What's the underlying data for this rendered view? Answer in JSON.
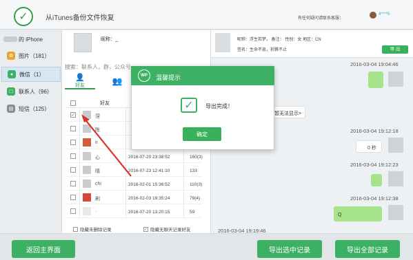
{
  "header": {
    "title": "从iTunes备份文件恢复",
    "note": "有任何疑问请联系客服：",
    "user_name": "4****5"
  },
  "sidebar": {
    "device": "的 iPhone",
    "items": [
      {
        "label": "图片（181）",
        "icon": "photos-icon",
        "color": "#e9a52b"
      },
      {
        "label": "微信（1）",
        "icon": "wechat-icon",
        "color": "#3cb063"
      },
      {
        "label": "联系人（96）",
        "icon": "contacts-icon",
        "color": "#3cb063"
      },
      {
        "label": "短信（125）",
        "icon": "sms-icon",
        "color": "#8c8c8c"
      }
    ]
  },
  "contacts": {
    "profile_label": "昵称：_",
    "search_placeholder": "搜索：联系人，群，公众号",
    "tab_friends": "好友",
    "header_label": "好友",
    "rows": [
      {
        "name": "涅",
        "date": "",
        "count": "",
        "checked": true
      },
      {
        "name": "陈",
        "date": "",
        "count": "",
        "checked": false
      },
      {
        "name": "ir",
        "date": "",
        "count": "",
        "checked": false
      },
      {
        "name": "心",
        "date": "2016-07-20 23:38:52",
        "count": "160(3)",
        "checked": false
      },
      {
        "name": "晴",
        "date": "2016-07-23 12:41:10",
        "count": "133",
        "checked": false
      },
      {
        "name": "chi",
        "date": "2016-02-01 15:36:52",
        "count": "110(3)",
        "checked": false
      },
      {
        "name": "刷",
        "date": "2016-02-03 19:35:24",
        "count": "79(4)",
        "checked": false
      },
      {
        "name": "·",
        "date": "2016-07-20 13:20:15",
        "count": "59",
        "checked": false
      }
    ],
    "footer_opt1": "隐藏未删除记录",
    "footer_opt2": "隐藏无聊天记录好友"
  },
  "chat": {
    "info_line1": "昵称：浮生若梦。    备注：        性别：女   地区：CN",
    "info_line2": "签名：生命不息，折腾不止",
    "export_small_label": "导 出",
    "timestamps": [
      "2016-03-04 19:04:46",
      "2016-03-04 19:12:18",
      "2016-03-04 19:12:23",
      "2016-03-04 19:12:38",
      "2016-03-04 19:19:46"
    ],
    "voice_label": "0 秒",
    "msg4_text": "Q",
    "link_text": "暂无法显示>"
  },
  "dialog": {
    "title": "温馨提示",
    "title_icon": "WP",
    "message": "导出完成！",
    "ok_label": "确定"
  },
  "bottom": {
    "back_label": "返回主界面",
    "export_selected_label": "导出选中记录",
    "export_all_label": "导出全部记录"
  }
}
